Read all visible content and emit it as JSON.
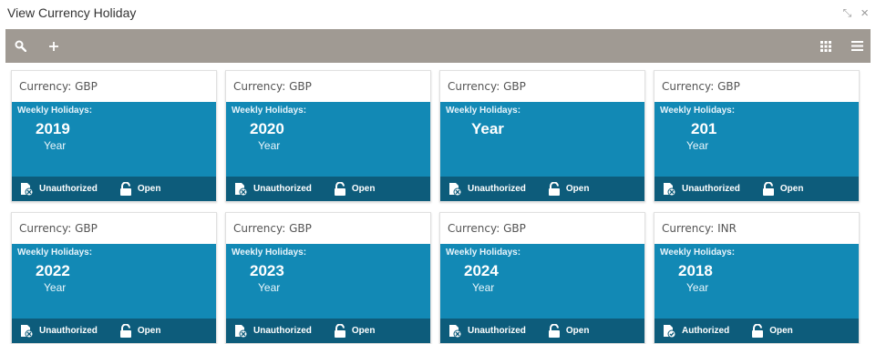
{
  "window": {
    "title": "View Currency Holiday",
    "minimize_glyph": "⤡",
    "close_glyph": "×"
  },
  "toolbar": {
    "left_icons": [
      "search-icon",
      "add-icon"
    ],
    "right_icons": [
      "grid-view-icon",
      "list-view-icon"
    ]
  },
  "cards": [
    {
      "currency_label": "Currency:",
      "currency": "GBP",
      "weekly_label": "Weekly Holidays:",
      "year": "2019",
      "year_label": "Year",
      "auth_status": "Unauthorized",
      "record_status": "Open"
    },
    {
      "currency_label": "Currency:",
      "currency": "GBP",
      "weekly_label": "Weekly Holidays:",
      "year": "2020",
      "year_label": "Year",
      "auth_status": "Unauthorized",
      "record_status": "Open"
    },
    {
      "currency_label": "Currency:",
      "currency": "GBP",
      "weekly_label": "Weekly Holidays:",
      "year": "Year",
      "year_label": "",
      "auth_status": "Unauthorized",
      "record_status": "Open"
    },
    {
      "currency_label": "Currency:",
      "currency": "GBP",
      "weekly_label": "Weekly Holidays:",
      "year": "201",
      "year_label": "Year",
      "auth_status": "Unauthorized",
      "record_status": "Open"
    },
    {
      "currency_label": "Currency:",
      "currency": "GBP",
      "weekly_label": "Weekly Holidays:",
      "year": "2022",
      "year_label": "Year",
      "auth_status": "Unauthorized",
      "record_status": "Open"
    },
    {
      "currency_label": "Currency:",
      "currency": "GBP",
      "weekly_label": "Weekly Holidays:",
      "year": "2023",
      "year_label": "Year",
      "auth_status": "Unauthorized",
      "record_status": "Open"
    },
    {
      "currency_label": "Currency:",
      "currency": "GBP",
      "weekly_label": "Weekly Holidays:",
      "year": "2024",
      "year_label": "Year",
      "auth_status": "Unauthorized",
      "record_status": "Open"
    },
    {
      "currency_label": "Currency:",
      "currency": "INR",
      "weekly_label": "Weekly Holidays:",
      "year": "2018",
      "year_label": "Year",
      "auth_status": "Authorized",
      "record_status": "Open"
    }
  ],
  "colors": {
    "toolbar": "#a09a93",
    "card_body": "#1289b5",
    "card_footer": "#0d5c7b"
  }
}
